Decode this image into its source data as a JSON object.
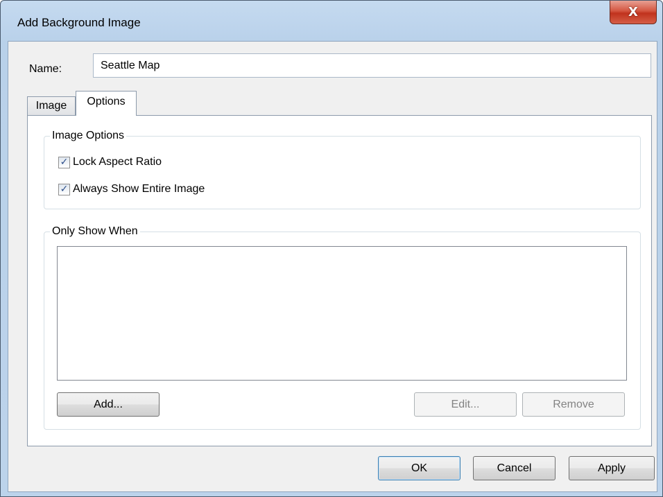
{
  "window": {
    "title": "Add Background Image",
    "close_glyph": "X"
  },
  "name_field": {
    "label": "Name:",
    "value": "Seattle Map"
  },
  "tabs": [
    {
      "label": "Image",
      "active": false
    },
    {
      "label": "Options",
      "active": true
    }
  ],
  "image_options": {
    "title": "Image Options",
    "lock_aspect_ratio": {
      "label": "Lock Aspect Ratio",
      "checked": true
    },
    "always_show_entire_image": {
      "label": "Always Show Entire Image",
      "checked": true
    }
  },
  "only_show_when": {
    "title": "Only Show When",
    "items": [],
    "add_label": "Add...",
    "edit_label": "Edit...",
    "remove_label": "Remove"
  },
  "footer": {
    "ok_label": "OK",
    "cancel_label": "Cancel",
    "apply_label": "Apply"
  },
  "icons": {
    "close": "close-icon",
    "check": "checkmark-icon"
  },
  "colors": {
    "titlebar": "#b9d1ea",
    "close_button": "#c7432e",
    "client_bg": "#f0f0f0",
    "default_button_border": "#3c7fb1"
  }
}
